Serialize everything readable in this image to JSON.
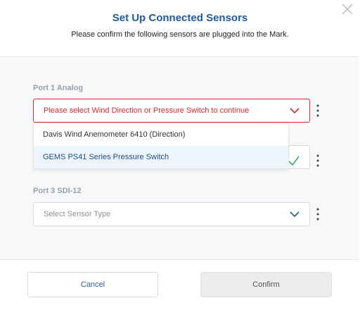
{
  "dialog": {
    "title": "Set Up Connected Sensors",
    "subtitle": "Please confirm the following sensors are plugged into the Mark."
  },
  "ports": [
    {
      "label": "Port 1 Analog",
      "select_text": "Please select Wind Direction or Pressure Switch to continue",
      "state": "error"
    },
    {
      "label": "",
      "select_text": "",
      "state": "valid"
    },
    {
      "label": "Port 3 SDI-12",
      "select_text": "Select Sensor Type",
      "state": "placeholder"
    }
  ],
  "dropdown": {
    "options": [
      "Davis Wind Anemometer 6410 (Direction)",
      "GEMS PS41 Series Pressure Switch"
    ],
    "highlighted_index": 1
  },
  "footer": {
    "cancel_label": "Cancel",
    "confirm_label": "Confirm"
  },
  "colors": {
    "title": "#1f5a9a",
    "error": "#d9292c",
    "valid_check": "#3bb35a",
    "chevron": "#1f5a9a"
  },
  "icons": {
    "close": "close-icon",
    "chevron": "chevron-down-icon",
    "kebab": "kebab-menu-icon",
    "check": "checkmark-icon"
  }
}
